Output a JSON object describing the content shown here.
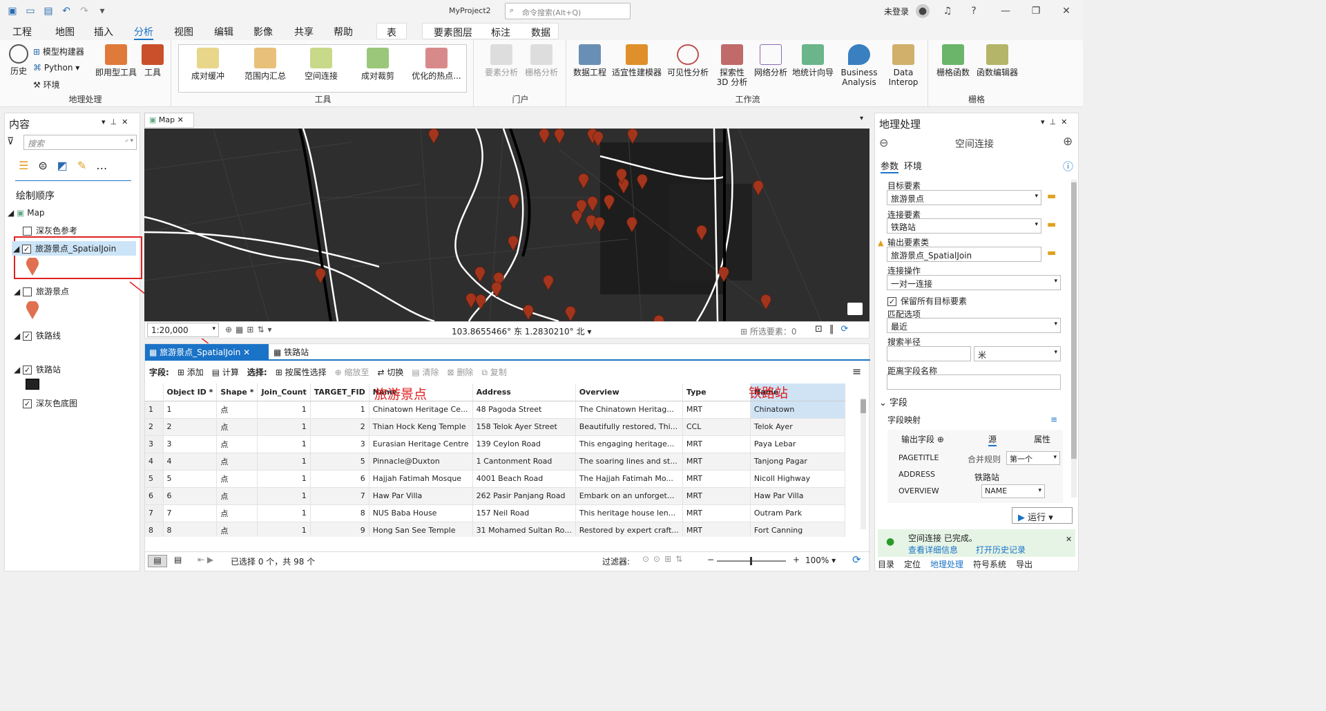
{
  "titlebar": {
    "project": "MyProject2",
    "command_search": "命令搜索(Alt+Q)",
    "account": "未登录"
  },
  "menu": {
    "tabs": [
      "工程",
      "地图",
      "插入",
      "分析",
      "视图",
      "编辑",
      "影像",
      "共享",
      "帮助"
    ],
    "context_tabs": [
      "表",
      "要素图层",
      "标注",
      "数据"
    ]
  },
  "ribbon": {
    "geoprocessing": {
      "title": "地理处理",
      "history": "历史",
      "modelbuilder": "模型构建器",
      "python": "Python",
      "env": "环境",
      "ready_tools": "即用型工具",
      "tools": "工具"
    },
    "tools": {
      "title": "工具",
      "items": [
        "成对缓冲",
        "范围内汇总",
        "空间连接",
        "成对裁剪",
        "优化的热点..."
      ]
    },
    "portal": {
      "title": "门户",
      "items": [
        "要素分析",
        "栅格分析"
      ]
    },
    "workflow": {
      "title": "工作流",
      "items": [
        "数据工程",
        "适宜性建模器",
        "可见性分析",
        "探索性 3D 分析",
        "网络分析",
        "地统计向导",
        "Business Analysis",
        "Data Interop"
      ]
    },
    "raster": {
      "title": "栅格",
      "items": [
        "栅格函数",
        "函数编辑器"
      ]
    }
  },
  "contents": {
    "title": "内容",
    "search_placeholder": "搜索",
    "drawing_order": "绘制顺序",
    "map": "Map",
    "layers": [
      "深灰色参考",
      "旅游景点_SpatialJoin",
      "旅游景点",
      "铁路线",
      "铁路站",
      "深灰色底图"
    ]
  },
  "map": {
    "tab": "Map",
    "scale": "1:20,000",
    "coords": "103.8655466° 东 1.2830210° 北",
    "selected": "所选要素：0"
  },
  "table": {
    "tabs": [
      "旅游景点_SpatialJoin",
      "铁路站"
    ],
    "toolbar": {
      "fields": "字段:",
      "add": "添加",
      "calc": "计算",
      "select": "选择:",
      "by_attr": "按属性选择",
      "zoom": "缩放至",
      "switch": "切换",
      "clear": "清除",
      "delete": "删除",
      "copy": "复制"
    },
    "headers": [
      "Object ID *",
      "Shape *",
      "Join_Count",
      "TARGET_FID",
      "Name",
      "Address",
      "Overview",
      "Type",
      "Name"
    ],
    "annot_left": "旅游景点",
    "annot_right": "铁路站",
    "rows": [
      [
        "1",
        "1",
        "点",
        "1",
        "1",
        "Chinatown Heritage Ce...",
        "48 Pagoda Street",
        "The Chinatown Heritag...",
        "MRT",
        "Chinatown"
      ],
      [
        "2",
        "2",
        "点",
        "1",
        "2",
        "Thian Hock Keng Temple",
        "158 Telok Ayer Street",
        "Beautifully restored, Thi...",
        "CCL",
        "Telok Ayer"
      ],
      [
        "3",
        "3",
        "点",
        "1",
        "3",
        "Eurasian Heritage Centre",
        "139 Ceylon Road",
        "This engaging heritage...",
        "MRT",
        "Paya Lebar"
      ],
      [
        "4",
        "4",
        "点",
        "1",
        "5",
        "Pinnacle@Duxton",
        "1 Cantonment Road",
        "The soaring lines and st...",
        "MRT",
        "Tanjong Pagar"
      ],
      [
        "5",
        "5",
        "点",
        "1",
        "6",
        "Hajjah Fatimah Mosque",
        "4001 Beach Road",
        "The Hajjah Fatimah Mo...",
        "MRT",
        "Nicoll Highway"
      ],
      [
        "6",
        "6",
        "点",
        "1",
        "7",
        "Haw Par Villa",
        "262 Pasir Panjang Road",
        "Embark on an unforget...",
        "MRT",
        "Haw Par Villa"
      ],
      [
        "7",
        "7",
        "点",
        "1",
        "8",
        "NUS Baba House",
        "157 Neil Road",
        "This heritage house len...",
        "MRT",
        "Outram Park"
      ],
      [
        "8",
        "8",
        "点",
        "1",
        "9",
        "Hong San See Temple",
        "31 Mohamed Sultan Ro...",
        "Restored by expert craft...",
        "MRT",
        "Fort Canning"
      ]
    ],
    "status": "已选择 0 个，共 98 个",
    "filter": "过滤器:",
    "zoom": "100%"
  },
  "gp": {
    "title": "地理处理",
    "tool": "空间连接",
    "tab_params": "参数",
    "tab_env": "环境",
    "target_label": "目标要素",
    "target": "旅游景点",
    "join_label": "连接要素",
    "join": "铁路站",
    "output_label": "输出要素类",
    "output": "旅游景点_SpatialJoin",
    "op_label": "连接操作",
    "op": "一对一连接",
    "keep": "保留所有目标要素",
    "match_label": "匹配选项",
    "match": "最近",
    "radius_label": "搜索半径",
    "radius_unit": "米",
    "distfield_label": "距离字段名称",
    "fields_section": "字段",
    "fieldmap": "字段映射",
    "out_fields": "输出字段",
    "src": "源",
    "attr": "属性",
    "fm_fields": [
      "PAGETITLE",
      "ADDRESS",
      "OVERVIEW"
    ],
    "merge_label": "合并规则",
    "merge": "第一个",
    "src_table": "铁路站",
    "src_field": "NAME",
    "run": "运行",
    "done": "空间连接 已完成。",
    "details": "查看详细信息",
    "history": "打开历史记录",
    "bottom_tabs": [
      "目录",
      "定位",
      "地理处理",
      "符号系统",
      "导出"
    ]
  },
  "colors": {
    "accent": "#1a73c7",
    "pin": "#a3351c",
    "annot": "#e02020",
    "mapbg": "#2e2e2e"
  }
}
